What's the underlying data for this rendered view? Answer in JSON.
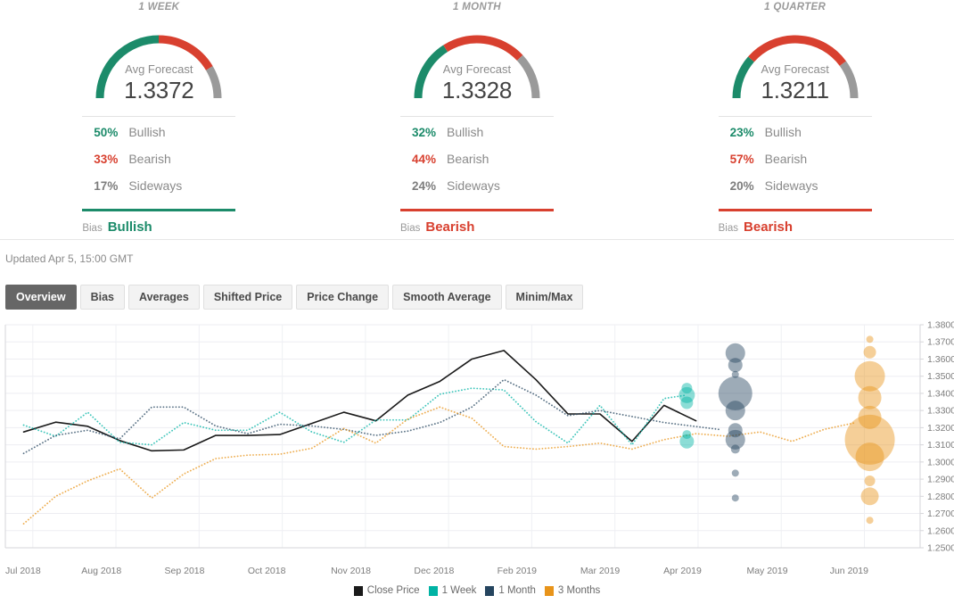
{
  "panels": [
    {
      "title": "1 WEEK",
      "gauge": {
        "label": "Avg Forecast",
        "value": "1.3372",
        "bullish_pct": 50,
        "bearish_pct": 33,
        "sideways_pct": 17
      },
      "rows": [
        {
          "pct": "50%",
          "label": "Bullish",
          "kind": "bull"
        },
        {
          "pct": "33%",
          "label": "Bearish",
          "kind": "bear"
        },
        {
          "pct": "17%",
          "label": "Sideways",
          "kind": "side"
        }
      ],
      "bias_word": "Bias",
      "bias_value": "Bullish",
      "bias_color": "#1c8b6a"
    },
    {
      "title": "1 MONTH",
      "gauge": {
        "label": "Avg Forecast",
        "value": "1.3328",
        "bullish_pct": 32,
        "bearish_pct": 44,
        "sideways_pct": 24
      },
      "rows": [
        {
          "pct": "32%",
          "label": "Bullish",
          "kind": "bull"
        },
        {
          "pct": "44%",
          "label": "Bearish",
          "kind": "bear"
        },
        {
          "pct": "24%",
          "label": "Sideways",
          "kind": "side"
        }
      ],
      "bias_word": "Bias",
      "bias_value": "Bearish",
      "bias_color": "#d8402f"
    },
    {
      "title": "1 QUARTER",
      "gauge": {
        "label": "Avg Forecast",
        "value": "1.3211",
        "bullish_pct": 23,
        "bearish_pct": 57,
        "sideways_pct": 20
      },
      "rows": [
        {
          "pct": "23%",
          "label": "Bullish",
          "kind": "bull"
        },
        {
          "pct": "57%",
          "label": "Bearish",
          "kind": "bear"
        },
        {
          "pct": "20%",
          "label": "Sideways",
          "kind": "side"
        }
      ],
      "bias_word": "Bias",
      "bias_value": "Bearish",
      "bias_color": "#d8402f"
    }
  ],
  "updated": "Updated Apr 5, 15:00 GMT",
  "tabs": [
    {
      "label": "Overview",
      "active": true
    },
    {
      "label": "Bias",
      "active": false
    },
    {
      "label": "Averages",
      "active": false
    },
    {
      "label": "Shifted Price",
      "active": false
    },
    {
      "label": "Price Change",
      "active": false
    },
    {
      "label": "Smooth Average",
      "active": false
    },
    {
      "label": "Minim/Max",
      "active": false
    }
  ],
  "colors": {
    "bullish": "#1c8b6a",
    "bearish": "#d8402f",
    "sideways": "#9a9a9a",
    "close_price": "#1a1a1a",
    "one_week": "#00b3a4",
    "one_month": "#25455f",
    "three_months": "#e8941a"
  },
  "chart_data": {
    "type": "line",
    "title": "",
    "xlabel": "",
    "ylabel": "",
    "ylim": [
      1.25,
      1.38
    ],
    "grid": true,
    "legend_position": "bottom",
    "ytick_labels": [
      "1.3800",
      "1.3700",
      "1.3600",
      "1.3500",
      "1.3400",
      "1.3300",
      "1.3200",
      "1.3100",
      "1.3000",
      "1.2900",
      "1.2800",
      "1.2700",
      "1.2600",
      "1.2500"
    ],
    "ytick_values": [
      1.38,
      1.37,
      1.36,
      1.35,
      1.34,
      1.33,
      1.32,
      1.31,
      1.3,
      1.29,
      1.28,
      1.27,
      1.26,
      1.25
    ],
    "xtick_labels": [
      "Jul 2018",
      "Aug 2018",
      "Sep 2018",
      "Oct 2018",
      "Nov 2018",
      "Dec 2018",
      "Feb 2019",
      "Mar 2019",
      "Apr 2019",
      "May 2019",
      "Jun 2019"
    ],
    "legend": [
      {
        "name": "Close Price",
        "color": "#1a1a1a"
      },
      {
        "name": "1 Week",
        "color": "#00b3a4"
      },
      {
        "name": "1 Month",
        "color": "#25455f"
      },
      {
        "name": "3 Months",
        "color": "#e8941a"
      }
    ],
    "series": [
      {
        "name": "Close Price",
        "color": "#1a1a1a",
        "style": "solid",
        "x": [
          0.02,
          0.055,
          0.09,
          0.125,
          0.16,
          0.195,
          0.23,
          0.265,
          0.3,
          0.335,
          0.37,
          0.405,
          0.44,
          0.475,
          0.51,
          0.545,
          0.58,
          0.615,
          0.65,
          0.685,
          0.72,
          0.755
        ],
        "values": [
          1.3175,
          1.3232,
          1.3208,
          1.3125,
          1.3065,
          1.307,
          1.3155,
          1.3155,
          1.316,
          1.3225,
          1.329,
          1.324,
          1.339,
          1.347,
          1.36,
          1.365,
          1.348,
          1.328,
          1.328,
          1.312,
          1.333,
          1.324
        ]
      },
      {
        "name": "1 Week",
        "color": "#00b3a4",
        "style": "dotted",
        "x": [
          0.02,
          0.055,
          0.09,
          0.125,
          0.16,
          0.195,
          0.23,
          0.265,
          0.3,
          0.335,
          0.37,
          0.405,
          0.44,
          0.475,
          0.51,
          0.545,
          0.58,
          0.615,
          0.65,
          0.685,
          0.72,
          0.745
        ],
        "values": [
          1.3215,
          1.315,
          1.329,
          1.3115,
          1.31,
          1.323,
          1.3185,
          1.3185,
          1.329,
          1.3175,
          1.3115,
          1.3245,
          1.3245,
          1.3395,
          1.343,
          1.342,
          1.3235,
          1.311,
          1.333,
          1.31,
          1.337,
          1.339
        ]
      },
      {
        "name": "1 Month",
        "color": "#25455f",
        "style": "dotted",
        "x": [
          0.02,
          0.055,
          0.09,
          0.125,
          0.16,
          0.195,
          0.23,
          0.265,
          0.3,
          0.335,
          0.37,
          0.405,
          0.44,
          0.475,
          0.51,
          0.545,
          0.58,
          0.615,
          0.65,
          0.685,
          0.72,
          0.78
        ],
        "values": [
          1.305,
          1.3155,
          1.3185,
          1.3135,
          1.332,
          1.332,
          1.321,
          1.3165,
          1.322,
          1.321,
          1.319,
          1.3155,
          1.318,
          1.323,
          1.332,
          1.348,
          1.339,
          1.327,
          1.33,
          1.3265,
          1.323,
          1.319
        ]
      },
      {
        "name": "3 Months",
        "color": "#e8941a",
        "style": "dotted",
        "x": [
          0.02,
          0.055,
          0.09,
          0.125,
          0.16,
          0.195,
          0.23,
          0.265,
          0.3,
          0.335,
          0.37,
          0.405,
          0.44,
          0.475,
          0.51,
          0.545,
          0.58,
          0.615,
          0.65,
          0.685,
          0.72,
          0.755,
          0.79,
          0.825,
          0.86,
          0.895,
          0.93
        ],
        "values": [
          1.264,
          1.28,
          1.289,
          1.296,
          1.279,
          1.293,
          1.302,
          1.304,
          1.3045,
          1.308,
          1.3195,
          1.311,
          1.325,
          1.332,
          1.3255,
          1.309,
          1.3075,
          1.309,
          1.311,
          1.3075,
          1.313,
          1.3165,
          1.315,
          1.3175,
          1.312,
          1.319,
          1.323
        ]
      }
    ],
    "bubbles": [
      {
        "series": "1 Week",
        "color": "#00b3a4",
        "x": 0.745,
        "y": 1.343,
        "r": 6
      },
      {
        "series": "1 Week",
        "color": "#00b3a4",
        "x": 0.745,
        "y": 1.339,
        "r": 9
      },
      {
        "series": "1 Week",
        "color": "#00b3a4",
        "x": 0.745,
        "y": 1.3345,
        "r": 7
      },
      {
        "series": "1 Week",
        "color": "#00b3a4",
        "x": 0.745,
        "y": 1.316,
        "r": 5
      },
      {
        "series": "1 Week",
        "color": "#00b3a4",
        "x": 0.745,
        "y": 1.312,
        "r": 8
      },
      {
        "series": "1 Month",
        "color": "#25455f",
        "x": 0.798,
        "y": 1.3635,
        "r": 11
      },
      {
        "series": "1 Month",
        "color": "#25455f",
        "x": 0.798,
        "y": 1.3565,
        "r": 8
      },
      {
        "series": "1 Month",
        "color": "#25455f",
        "x": 0.798,
        "y": 1.351,
        "r": 4
      },
      {
        "series": "1 Month",
        "color": "#25455f",
        "x": 0.798,
        "y": 1.34,
        "r": 19
      },
      {
        "series": "1 Month",
        "color": "#25455f",
        "x": 0.798,
        "y": 1.33,
        "r": 11
      },
      {
        "series": "1 Month",
        "color": "#25455f",
        "x": 0.798,
        "y": 1.3185,
        "r": 8
      },
      {
        "series": "1 Month",
        "color": "#25455f",
        "x": 0.798,
        "y": 1.313,
        "r": 11
      },
      {
        "series": "1 Month",
        "color": "#25455f",
        "x": 0.798,
        "y": 1.3075,
        "r": 5
      },
      {
        "series": "1 Month",
        "color": "#25455f",
        "x": 0.798,
        "y": 1.2935,
        "r": 4
      },
      {
        "series": "1 Month",
        "color": "#25455f",
        "x": 0.798,
        "y": 1.279,
        "r": 4
      },
      {
        "series": "3 Months",
        "color": "#e8941a",
        "x": 0.945,
        "y": 1.3715,
        "r": 4
      },
      {
        "series": "3 Months",
        "color": "#e8941a",
        "x": 0.945,
        "y": 1.364,
        "r": 7
      },
      {
        "series": "3 Months",
        "color": "#e8941a",
        "x": 0.945,
        "y": 1.35,
        "r": 17
      },
      {
        "series": "3 Months",
        "color": "#e8941a",
        "x": 0.945,
        "y": 1.3375,
        "r": 13
      },
      {
        "series": "3 Months",
        "color": "#e8941a",
        "x": 0.945,
        "y": 1.326,
        "r": 13
      },
      {
        "series": "3 Months",
        "color": "#e8941a",
        "x": 0.945,
        "y": 1.313,
        "r": 28
      },
      {
        "series": "3 Months",
        "color": "#e8941a",
        "x": 0.945,
        "y": 1.303,
        "r": 16
      },
      {
        "series": "3 Months",
        "color": "#e8941a",
        "x": 0.945,
        "y": 1.289,
        "r": 6
      },
      {
        "series": "3 Months",
        "color": "#e8941a",
        "x": 0.945,
        "y": 1.28,
        "r": 10
      },
      {
        "series": "3 Months",
        "color": "#e8941a",
        "x": 0.945,
        "y": 1.266,
        "r": 4
      }
    ]
  }
}
